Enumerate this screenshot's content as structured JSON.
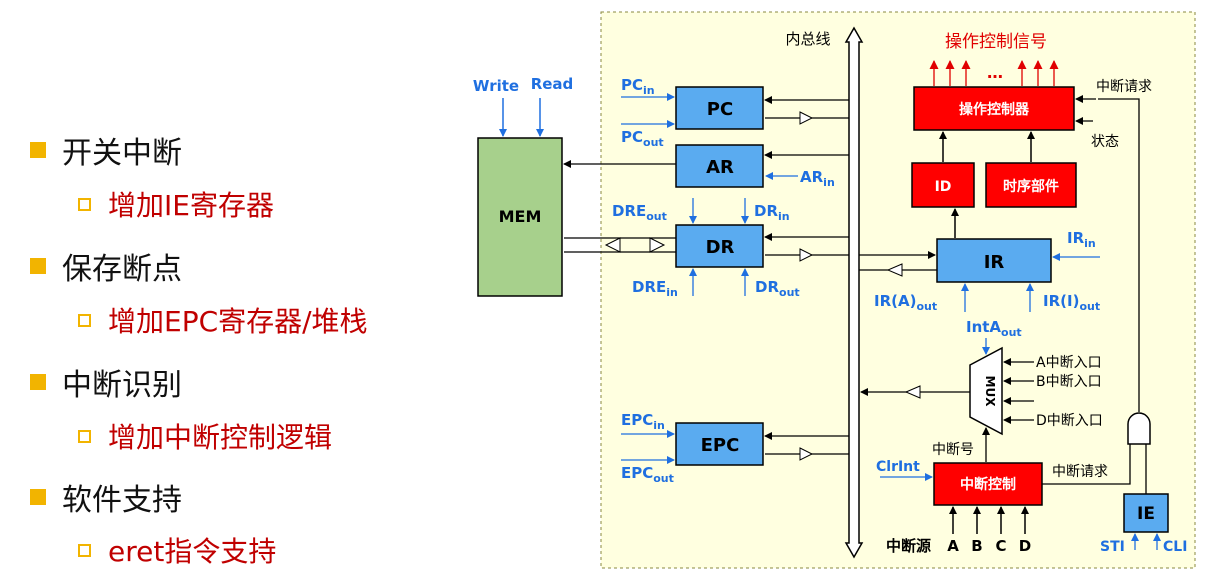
{
  "bullets": [
    {
      "level": 1,
      "text": "开关中断"
    },
    {
      "level": 2,
      "text": "增加IE寄存器"
    },
    {
      "level": 1,
      "text": "保存断点"
    },
    {
      "level": 2,
      "text": "增加EPC寄存器/堆栈"
    },
    {
      "level": 1,
      "text": "中断识别"
    },
    {
      "level": 2,
      "text": "增加中断控制逻辑"
    },
    {
      "level": 1,
      "text": "软件支持"
    },
    {
      "level": 2,
      "text": "eret指令支持"
    }
  ],
  "diagram": {
    "mem": "MEM",
    "mem_write": "Write",
    "mem_read": "Read",
    "pc": "PC",
    "ar": "AR",
    "dr": "DR",
    "epc": "EPC",
    "ir": "IR",
    "ie": "IE",
    "id": "ID",
    "timing": "时序部件",
    "op_controller": "操作控制器",
    "int_controller": "中断控制",
    "mux": "MUX",
    "bus": "内总线",
    "op_signals": "操作控制信号",
    "dots": "…",
    "int_request_1": "中断请求",
    "int_request_2": "中断请求",
    "status": "状态",
    "int_number": "中断号",
    "int_source": "中断源",
    "sources": [
      "A",
      "B",
      "C",
      "D"
    ],
    "mux_inputs": [
      "A中断入口",
      "B中断入口",
      "D中断入口"
    ],
    "signals": {
      "pc_in": {
        "base": "PC",
        "sub": "in"
      },
      "pc_out": {
        "base": "PC",
        "sub": "out"
      },
      "ar_in": {
        "base": "AR",
        "sub": "in"
      },
      "dre_out": {
        "base": "DRE",
        "sub": "out"
      },
      "dr_in": {
        "base": "DR",
        "sub": "in"
      },
      "dre_in": {
        "base": "DRE",
        "sub": "in"
      },
      "dr_out": {
        "base": "DR",
        "sub": "out"
      },
      "ir_in": {
        "base": "IR",
        "sub": "in"
      },
      "ira_out": {
        "base": "IR(A)",
        "sub": "out"
      },
      "iri_out": {
        "base": "IR(I)",
        "sub": "out"
      },
      "inta_out": {
        "base": "IntA",
        "sub": "out"
      },
      "epc_in": {
        "base": "EPC",
        "sub": "in"
      },
      "epc_out": {
        "base": "EPC",
        "sub": "out"
      },
      "clrint": "ClrInt",
      "sti": "STI",
      "cli": "CLI"
    }
  },
  "colors": {
    "panel_bg": "#ffffe0",
    "register": "#5aabf0",
    "mem": "#a7d08c",
    "control": "#ff0000",
    "signal_text": "#1f6fe0",
    "bullet_marker": "#f2b400",
    "sub_bullet_text": "#c00000"
  }
}
